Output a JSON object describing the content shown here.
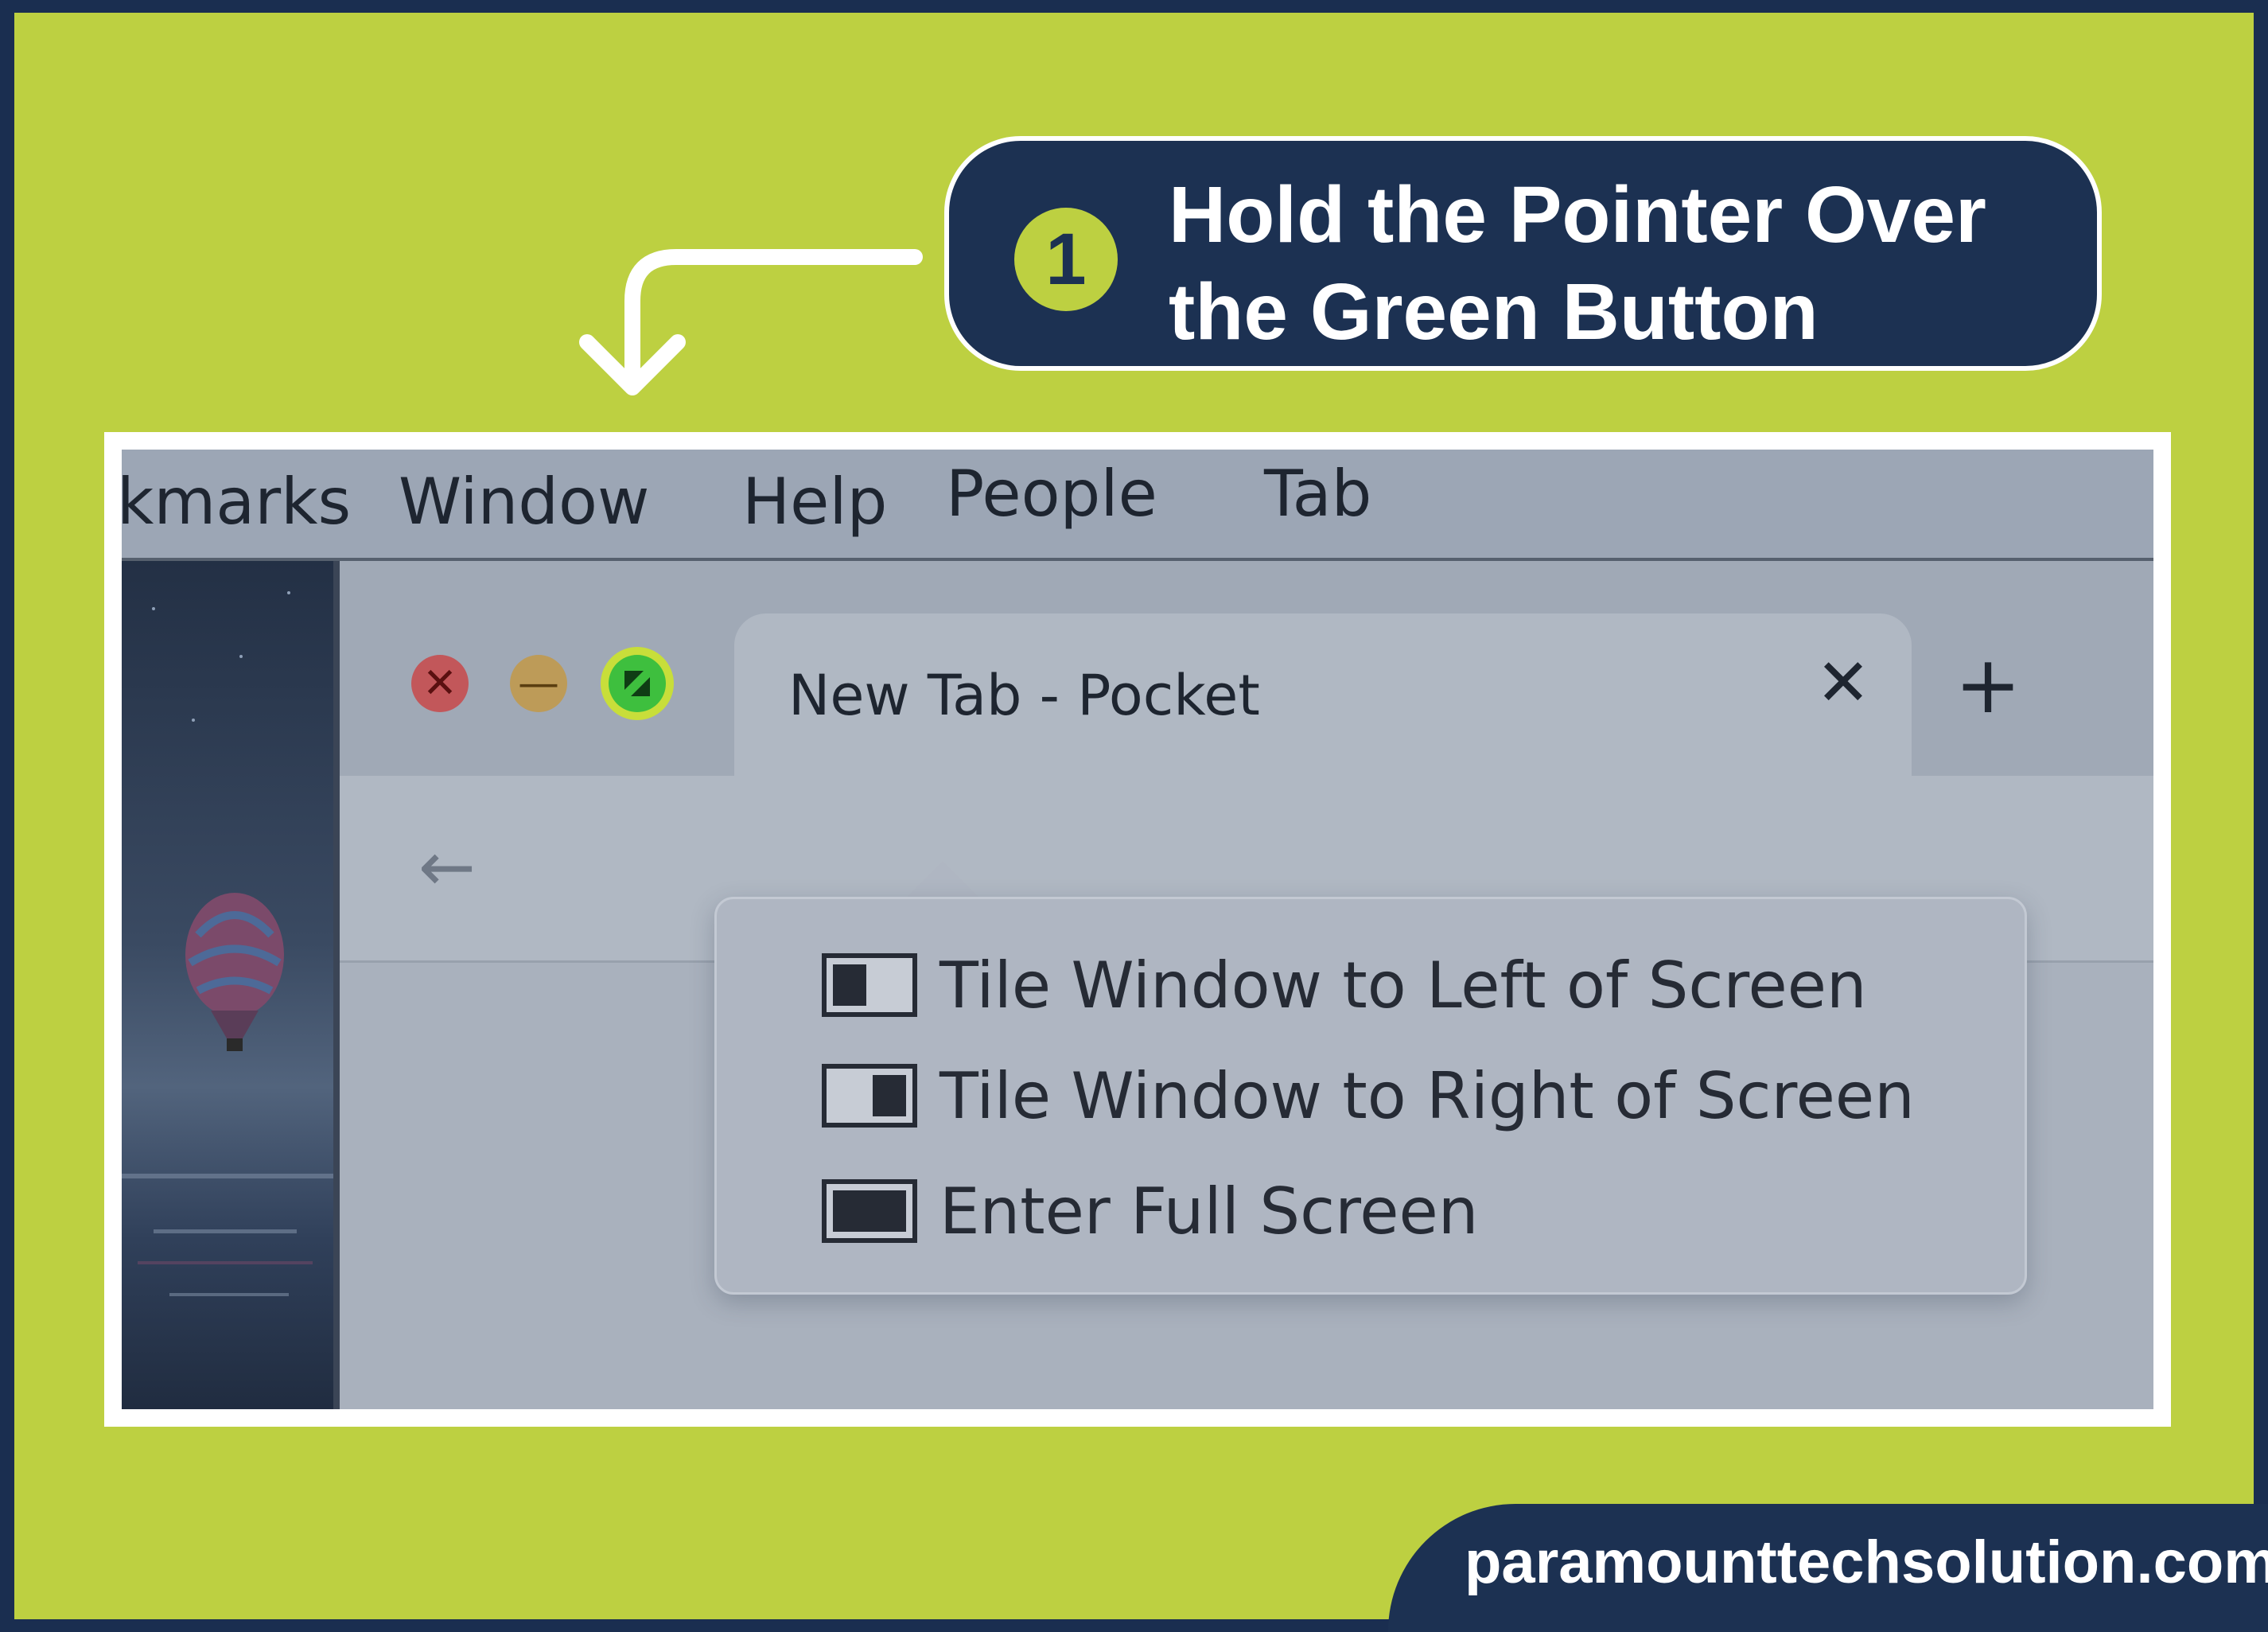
{
  "callout": {
    "step": "1",
    "line1": "Hold the Pointer Over",
    "line2": "the Green Button"
  },
  "menubar": {
    "items": [
      "kmarks",
      "Window",
      "Help",
      "People",
      "Tab"
    ]
  },
  "browser": {
    "tab_title": "New Tab - Pocket",
    "tab_close_icon": "close-icon",
    "new_tab_icon": "plus-icon",
    "back_icon": "arrow-left-icon"
  },
  "window_controls": {
    "close_icon": "close-icon",
    "minimize_icon": "minus-icon",
    "zoom_icon": "fullscreen-icon"
  },
  "popup_menu": {
    "items": [
      {
        "label": "Tile Window to Left of Screen",
        "icon": "tile-left-icon"
      },
      {
        "label": "Tile Window to Right of Screen",
        "icon": "tile-right-icon"
      },
      {
        "label": "Enter Full Screen",
        "icon": "fullscreen-icon"
      }
    ]
  },
  "footer": {
    "website": "paramounttechsolution.com"
  },
  "colors": {
    "background": "#bdd041",
    "navy": "#1c3152",
    "highlight": "#c8de3a",
    "zoom_button": "#3ebf3e",
    "close_button": "#c2575a",
    "minimize_button": "#bd9b58"
  }
}
